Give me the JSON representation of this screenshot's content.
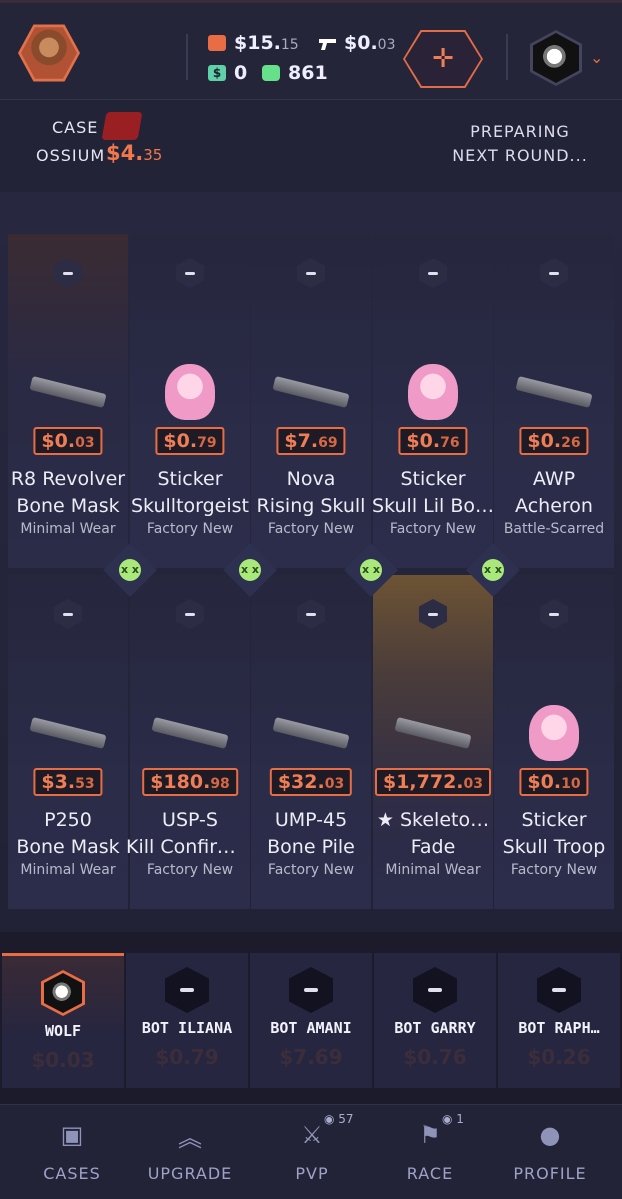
{
  "header": {
    "balance_main": "$15.",
    "balance_main_cents": "15",
    "balance_gun": "$0.",
    "balance_gun_cents": "03",
    "balance_cash": "0",
    "balance_points": "861",
    "add_icon": "crosshair-plus-icon"
  },
  "case": {
    "label": "CASE",
    "name": "OSSIUM",
    "price": "$4.",
    "price_cents": "35",
    "status_line1": "PREPARING",
    "status_line2": "NEXT ROUND..."
  },
  "grid": {
    "row1": [
      {
        "price": "$0.",
        "cents": "03",
        "name1": "R8 Revolver",
        "name2": "Bone Mask",
        "wear": "Minimal Wear"
      },
      {
        "price": "$0.",
        "cents": "79",
        "name1": "Sticker",
        "name2": "Skulltorgeist",
        "wear": "Factory New"
      },
      {
        "price": "$7.",
        "cents": "69",
        "name1": "Nova",
        "name2": "Rising Skull",
        "wear": "Factory New"
      },
      {
        "price": "$0.",
        "cents": "76",
        "name1": "Sticker",
        "name2": "Skull Lil Bo…",
        "wear": "Factory New"
      },
      {
        "price": "$0.",
        "cents": "26",
        "name1": "AWP",
        "name2": "Acheron",
        "wear": "Battle-Scarred"
      }
    ],
    "row2": [
      {
        "price": "$3.",
        "cents": "53",
        "name1": "P250",
        "name2": "Bone Mask",
        "wear": "Minimal Wear"
      },
      {
        "price": "$180.",
        "cents": "98",
        "name1": "USP-S",
        "name2": "Kill Confirm…",
        "wear": "Factory New"
      },
      {
        "price": "$32.",
        "cents": "03",
        "name1": "UMP-45",
        "name2": "Bone Pile",
        "wear": "Factory New"
      },
      {
        "price": "$1,772.",
        "cents": "03",
        "name1": "★ Skeleto…",
        "name2": "Fade",
        "wear": "Minimal Wear"
      },
      {
        "price": "$0.",
        "cents": "10",
        "name1": "Sticker",
        "name2": "Skull Troop",
        "wear": "Factory New"
      }
    ]
  },
  "players": [
    {
      "name": "WOLF",
      "value": "$0.03"
    },
    {
      "name": "BOT ILIANA",
      "value": "$0.79"
    },
    {
      "name": "BOT AMANI",
      "value": "$7.69"
    },
    {
      "name": "BOT GARRY",
      "value": "$0.76"
    },
    {
      "name": "BOT RAPH…",
      "value": "$0.26"
    }
  ],
  "nav": {
    "items": [
      {
        "label": "CASES",
        "icon": "briefcase-icon"
      },
      {
        "label": "UPGRADE",
        "icon": "double-chevron-up-icon"
      },
      {
        "label": "PVP",
        "icon": "crossed-swords-icon",
        "badge": "57"
      },
      {
        "label": "RACE",
        "icon": "flag-icon",
        "badge": "1"
      },
      {
        "label": "PROFILE",
        "icon": "user-icon"
      }
    ]
  },
  "colors": {
    "accent": "#e86d44",
    "background": "#1e1e30",
    "smile": "#a9e87a"
  }
}
